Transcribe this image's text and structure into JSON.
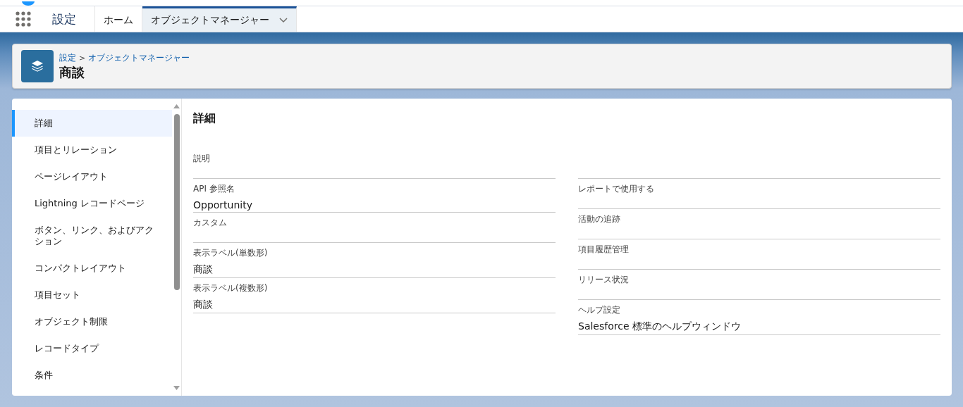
{
  "nav": {
    "app_name": "設定",
    "tabs": [
      {
        "label": "ホーム",
        "selected": false,
        "menu": false
      },
      {
        "label": "オブジェクトマネージャー",
        "selected": true,
        "menu": true
      }
    ]
  },
  "header": {
    "breadcrumb": [
      {
        "label": "設定"
      },
      {
        "label": "オブジェクトマネージャー"
      }
    ],
    "separator": ">",
    "title": "商談"
  },
  "sidebar": {
    "items": [
      {
        "label": "詳細",
        "selected": true
      },
      {
        "label": "項目とリレーション",
        "selected": false
      },
      {
        "label": "ページレイアウト",
        "selected": false
      },
      {
        "label": "Lightning レコードページ",
        "selected": false
      },
      {
        "label": "ボタン、リンク、およびアクション",
        "selected": false
      },
      {
        "label": "コンパクトレイアウト",
        "selected": false
      },
      {
        "label": "項目セット",
        "selected": false
      },
      {
        "label": "オブジェクト制限",
        "selected": false
      },
      {
        "label": "レコードタイプ",
        "selected": false
      },
      {
        "label": "条件",
        "selected": false
      }
    ]
  },
  "detail": {
    "title": "詳細",
    "left_fields": [
      {
        "kind": "field",
        "label": "説明",
        "tall": true
      },
      {
        "kind": "field",
        "label": "API 参照名",
        "value": "Opportunity"
      },
      {
        "kind": "field",
        "label": "カスタム"
      },
      {
        "kind": "field",
        "label": "表示ラベル(単数形)",
        "value": "商談"
      },
      {
        "kind": "field",
        "label": "表示ラベル(複数形)",
        "value": "商談"
      }
    ],
    "right_fields": [
      {
        "kind": "blank",
        "tall": true
      },
      {
        "kind": "field",
        "label": "レポートで使用する"
      },
      {
        "kind": "field",
        "label": "活動の追跡"
      },
      {
        "kind": "field",
        "label": "項目履歴管理"
      },
      {
        "kind": "field",
        "label": "リリース状況"
      },
      {
        "kind": "field",
        "label": "ヘルプ設定",
        "value": "Salesforce 標準のヘルプウィンドウ"
      }
    ]
  }
}
